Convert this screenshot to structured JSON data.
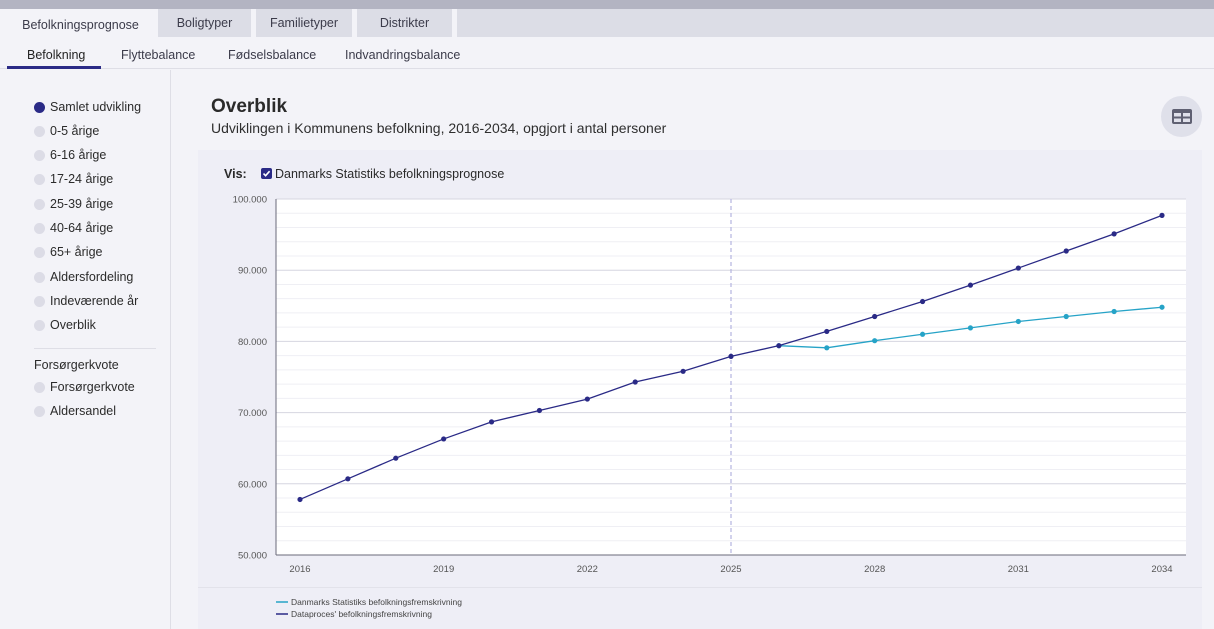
{
  "top_tabs": [
    {
      "label": "Befolkningsprognose",
      "active": true
    },
    {
      "label": "Boligtyper",
      "active": false
    },
    {
      "label": "Familietyper",
      "active": false
    },
    {
      "label": "Distrikter",
      "active": false
    }
  ],
  "sub_tabs": [
    {
      "label": "Befolkning",
      "active": true
    },
    {
      "label": "Flyttebalance",
      "active": false
    },
    {
      "label": "Fødselsbalance",
      "active": false
    },
    {
      "label": "Indvandringsbalance",
      "active": false
    }
  ],
  "sidebar": {
    "items": [
      {
        "label": "Samlet udvikling",
        "active": true
      },
      {
        "label": "0-5 årige",
        "active": false
      },
      {
        "label": "6-16 årige",
        "active": false
      },
      {
        "label": "17-24 årige",
        "active": false
      },
      {
        "label": "25-39 årige",
        "active": false
      },
      {
        "label": "40-64 årige",
        "active": false
      },
      {
        "label": "65+ årige",
        "active": false
      },
      {
        "label": "Aldersfordeling",
        "active": false
      },
      {
        "label": "Indeværende år",
        "active": false
      },
      {
        "label": "Overblik",
        "active": false
      }
    ],
    "section_heading": "Forsørgerkvote",
    "section_items": [
      {
        "label": "Forsørgerkvote",
        "active": false
      },
      {
        "label": "Aldersandel",
        "active": false
      }
    ]
  },
  "main": {
    "title": "Overblik",
    "subtitle": "Udviklingen i Kommunens befolkning, 2016-2034, opgjort i antal personer",
    "table_button_icon": "table-icon",
    "vis_label": "Vis:",
    "vis_checkbox_label": "Danmarks Statistiks befolkningsprognose",
    "vis_checkbox_checked": true
  },
  "colors": {
    "accent": "#2a2a86",
    "series_dst": "#26a3c7",
    "series_dataproces": "#2a2a86"
  },
  "chart_data": {
    "type": "line",
    "title": "",
    "xlabel": "",
    "ylabel": "",
    "x_ticks": [
      "2016",
      "2019",
      "2022",
      "2025",
      "2028",
      "2031",
      "2034"
    ],
    "y_ticks": [
      "50.000",
      "60.000",
      "70.000",
      "80.000",
      "90.000",
      "100.000"
    ],
    "xlim": [
      2016,
      2034
    ],
    "ylim": [
      50000,
      100000
    ],
    "grid": true,
    "legend_placement": "bottom-left",
    "reference_line_x": 2025,
    "series": [
      {
        "name": "Danmarks Statistiks befolkningsfremskrivning",
        "color": "#26a3c7",
        "x": [
          2026,
          2027,
          2028,
          2029,
          2030,
          2031,
          2032,
          2033,
          2034
        ],
        "y": [
          79400,
          79100,
          80100,
          81000,
          81900,
          82800,
          83500,
          84200,
          84800
        ]
      },
      {
        "name": "Dataproces' befolkningsfremskrivning",
        "color": "#2a2a86",
        "x": [
          2016,
          2017,
          2018,
          2019,
          2020,
          2021,
          2022,
          2023,
          2024,
          2025,
          2026,
          2027,
          2028,
          2029,
          2030,
          2031,
          2032,
          2033,
          2034
        ],
        "y": [
          57800,
          60700,
          63600,
          66300,
          68700,
          70300,
          71900,
          74300,
          75800,
          77900,
          79400,
          81400,
          83500,
          85600,
          87900,
          90300,
          92700,
          95100,
          97700
        ]
      }
    ]
  }
}
